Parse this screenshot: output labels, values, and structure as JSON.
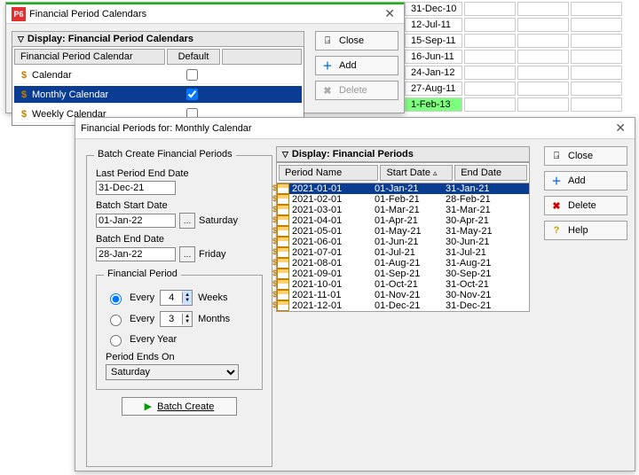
{
  "bg_dates": [
    "31-Dec-10",
    "12-Jul-11",
    "15-Sep-11",
    "16-Jun-11",
    "24-Jan-12",
    "27-Aug-11",
    "1-Feb-13"
  ],
  "win1": {
    "title": "Financial Period Calendars",
    "display": "Display: Financial Period Calendars",
    "col_name": "Financial Period Calendar",
    "col_default": "Default",
    "rows": [
      {
        "name": "Calendar",
        "default": false,
        "selected": false
      },
      {
        "name": "Monthly Calendar",
        "default": true,
        "selected": true
      },
      {
        "name": "Weekly Calendar",
        "default": false,
        "selected": false
      }
    ],
    "btn_close": "Close",
    "btn_add": "Add",
    "btn_delete": "Delete"
  },
  "win2": {
    "title": "Financial Periods for: Monthly Calendar",
    "batch_legend": "Batch Create Financial Periods",
    "last_period_label": "Last Period End Date",
    "last_period_value": "31-Dec-21",
    "batch_start_label": "Batch Start Date",
    "batch_start_value": "01-Jan-22",
    "batch_start_day": "Saturday",
    "batch_end_label": "Batch End Date",
    "batch_end_value": "28-Jan-22",
    "batch_end_day": "Friday",
    "fp_legend": "Financial Period",
    "every_label": "Every",
    "weeks_value": "4",
    "weeks_label": "Weeks",
    "months_value": "3",
    "months_label": "Months",
    "every_year_label": "Every Year",
    "period_ends_label": "Period Ends On",
    "period_ends_value": "Saturday",
    "batch_create_label": "Batch Create",
    "display_periods": "Display: Financial Periods",
    "col_period": "Period Name",
    "col_start": "Start Date",
    "col_end": "End Date",
    "periods": [
      {
        "name": "2021-01-01",
        "start": "01-Jan-21",
        "end": "31-Jan-21",
        "selected": true
      },
      {
        "name": "2021-02-01",
        "start": "01-Feb-21",
        "end": "28-Feb-21"
      },
      {
        "name": "2021-03-01",
        "start": "01-Mar-21",
        "end": "31-Mar-21"
      },
      {
        "name": "2021-04-01",
        "start": "01-Apr-21",
        "end": "30-Apr-21"
      },
      {
        "name": "2021-05-01",
        "start": "01-May-21",
        "end": "31-May-21"
      },
      {
        "name": "2021-06-01",
        "start": "01-Jun-21",
        "end": "30-Jun-21"
      },
      {
        "name": "2021-07-01",
        "start": "01-Jul-21",
        "end": "31-Jul-21"
      },
      {
        "name": "2021-08-01",
        "start": "01-Aug-21",
        "end": "31-Aug-21"
      },
      {
        "name": "2021-09-01",
        "start": "01-Sep-21",
        "end": "30-Sep-21"
      },
      {
        "name": "2021-10-01",
        "start": "01-Oct-21",
        "end": "31-Oct-21"
      },
      {
        "name": "2021-11-01",
        "start": "01-Nov-21",
        "end": "30-Nov-21"
      },
      {
        "name": "2021-12-01",
        "start": "01-Dec-21",
        "end": "31-Dec-21"
      }
    ],
    "btn_close": "Close",
    "btn_add": "Add",
    "btn_delete": "Delete",
    "btn_help": "Help"
  }
}
